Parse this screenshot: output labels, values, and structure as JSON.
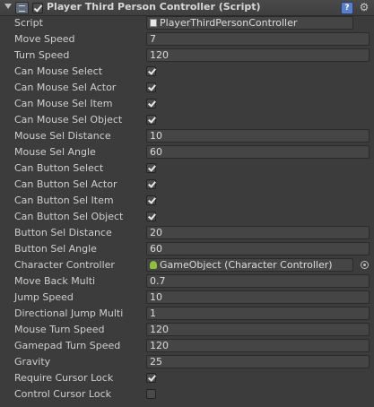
{
  "header": {
    "title": "Player Third Person Controller (Script)",
    "enabled": true,
    "icons": [
      "fold-triangle-icon",
      "script-icon",
      "help-icon",
      "gear-icon"
    ]
  },
  "fields": [
    {
      "key": "script",
      "label": "Script",
      "type": "object",
      "value": "PlayerThirdPersonController",
      "icon": "script"
    },
    {
      "key": "move_speed",
      "label": "Move Speed",
      "type": "text",
      "value": "7"
    },
    {
      "key": "turn_speed",
      "label": "Turn Speed",
      "type": "text",
      "value": "120"
    },
    {
      "key": "can_mouse_select",
      "label": "Can Mouse Select",
      "type": "bool",
      "value": true
    },
    {
      "key": "can_mouse_sel_actor",
      "label": "Can Mouse Sel Actor",
      "type": "bool",
      "value": true
    },
    {
      "key": "can_mouse_sel_item",
      "label": "Can Mouse Sel Item",
      "type": "bool",
      "value": true
    },
    {
      "key": "can_mouse_sel_object",
      "label": "Can Mouse Sel Object",
      "type": "bool",
      "value": true
    },
    {
      "key": "mouse_sel_distance",
      "label": "Mouse Sel Distance",
      "type": "text",
      "value": "10"
    },
    {
      "key": "mouse_sel_angle",
      "label": "Mouse Sel Angle",
      "type": "text",
      "value": "60"
    },
    {
      "key": "can_button_select",
      "label": "Can Button Select",
      "type": "bool",
      "value": true
    },
    {
      "key": "can_button_sel_actor",
      "label": "Can Button Sel Actor",
      "type": "bool",
      "value": true
    },
    {
      "key": "can_button_sel_item",
      "label": "Can Button Sel Item",
      "type": "bool",
      "value": true
    },
    {
      "key": "can_button_sel_object",
      "label": "Can Button Sel Object",
      "type": "bool",
      "value": true
    },
    {
      "key": "button_sel_distance",
      "label": "Button Sel Distance",
      "type": "text",
      "value": "20"
    },
    {
      "key": "button_sel_angle",
      "label": "Button Sel Angle",
      "type": "text",
      "value": "60"
    },
    {
      "key": "character_controller",
      "label": "Character Controller",
      "type": "object",
      "value": "GameObject (Character Controller)",
      "icon": "go"
    },
    {
      "key": "move_back_multi",
      "label": "Move Back Multi",
      "type": "text",
      "value": "0.7"
    },
    {
      "key": "jump_speed",
      "label": "Jump Speed",
      "type": "text",
      "value": "10"
    },
    {
      "key": "directional_jump_multi",
      "label": "Directional Jump Multi",
      "type": "text",
      "value": "1"
    },
    {
      "key": "mouse_turn_speed",
      "label": "Mouse Turn Speed",
      "type": "text",
      "value": "120"
    },
    {
      "key": "gamepad_turn_speed",
      "label": "Gamepad Turn Speed",
      "type": "text",
      "value": "120"
    },
    {
      "key": "gravity",
      "label": "Gravity",
      "type": "text",
      "value": "25"
    },
    {
      "key": "require_cursor_lock",
      "label": "Require Cursor Lock",
      "type": "bool",
      "value": true
    },
    {
      "key": "control_cursor_lock",
      "label": "Control Cursor Lock",
      "type": "bool",
      "value": false
    }
  ]
}
